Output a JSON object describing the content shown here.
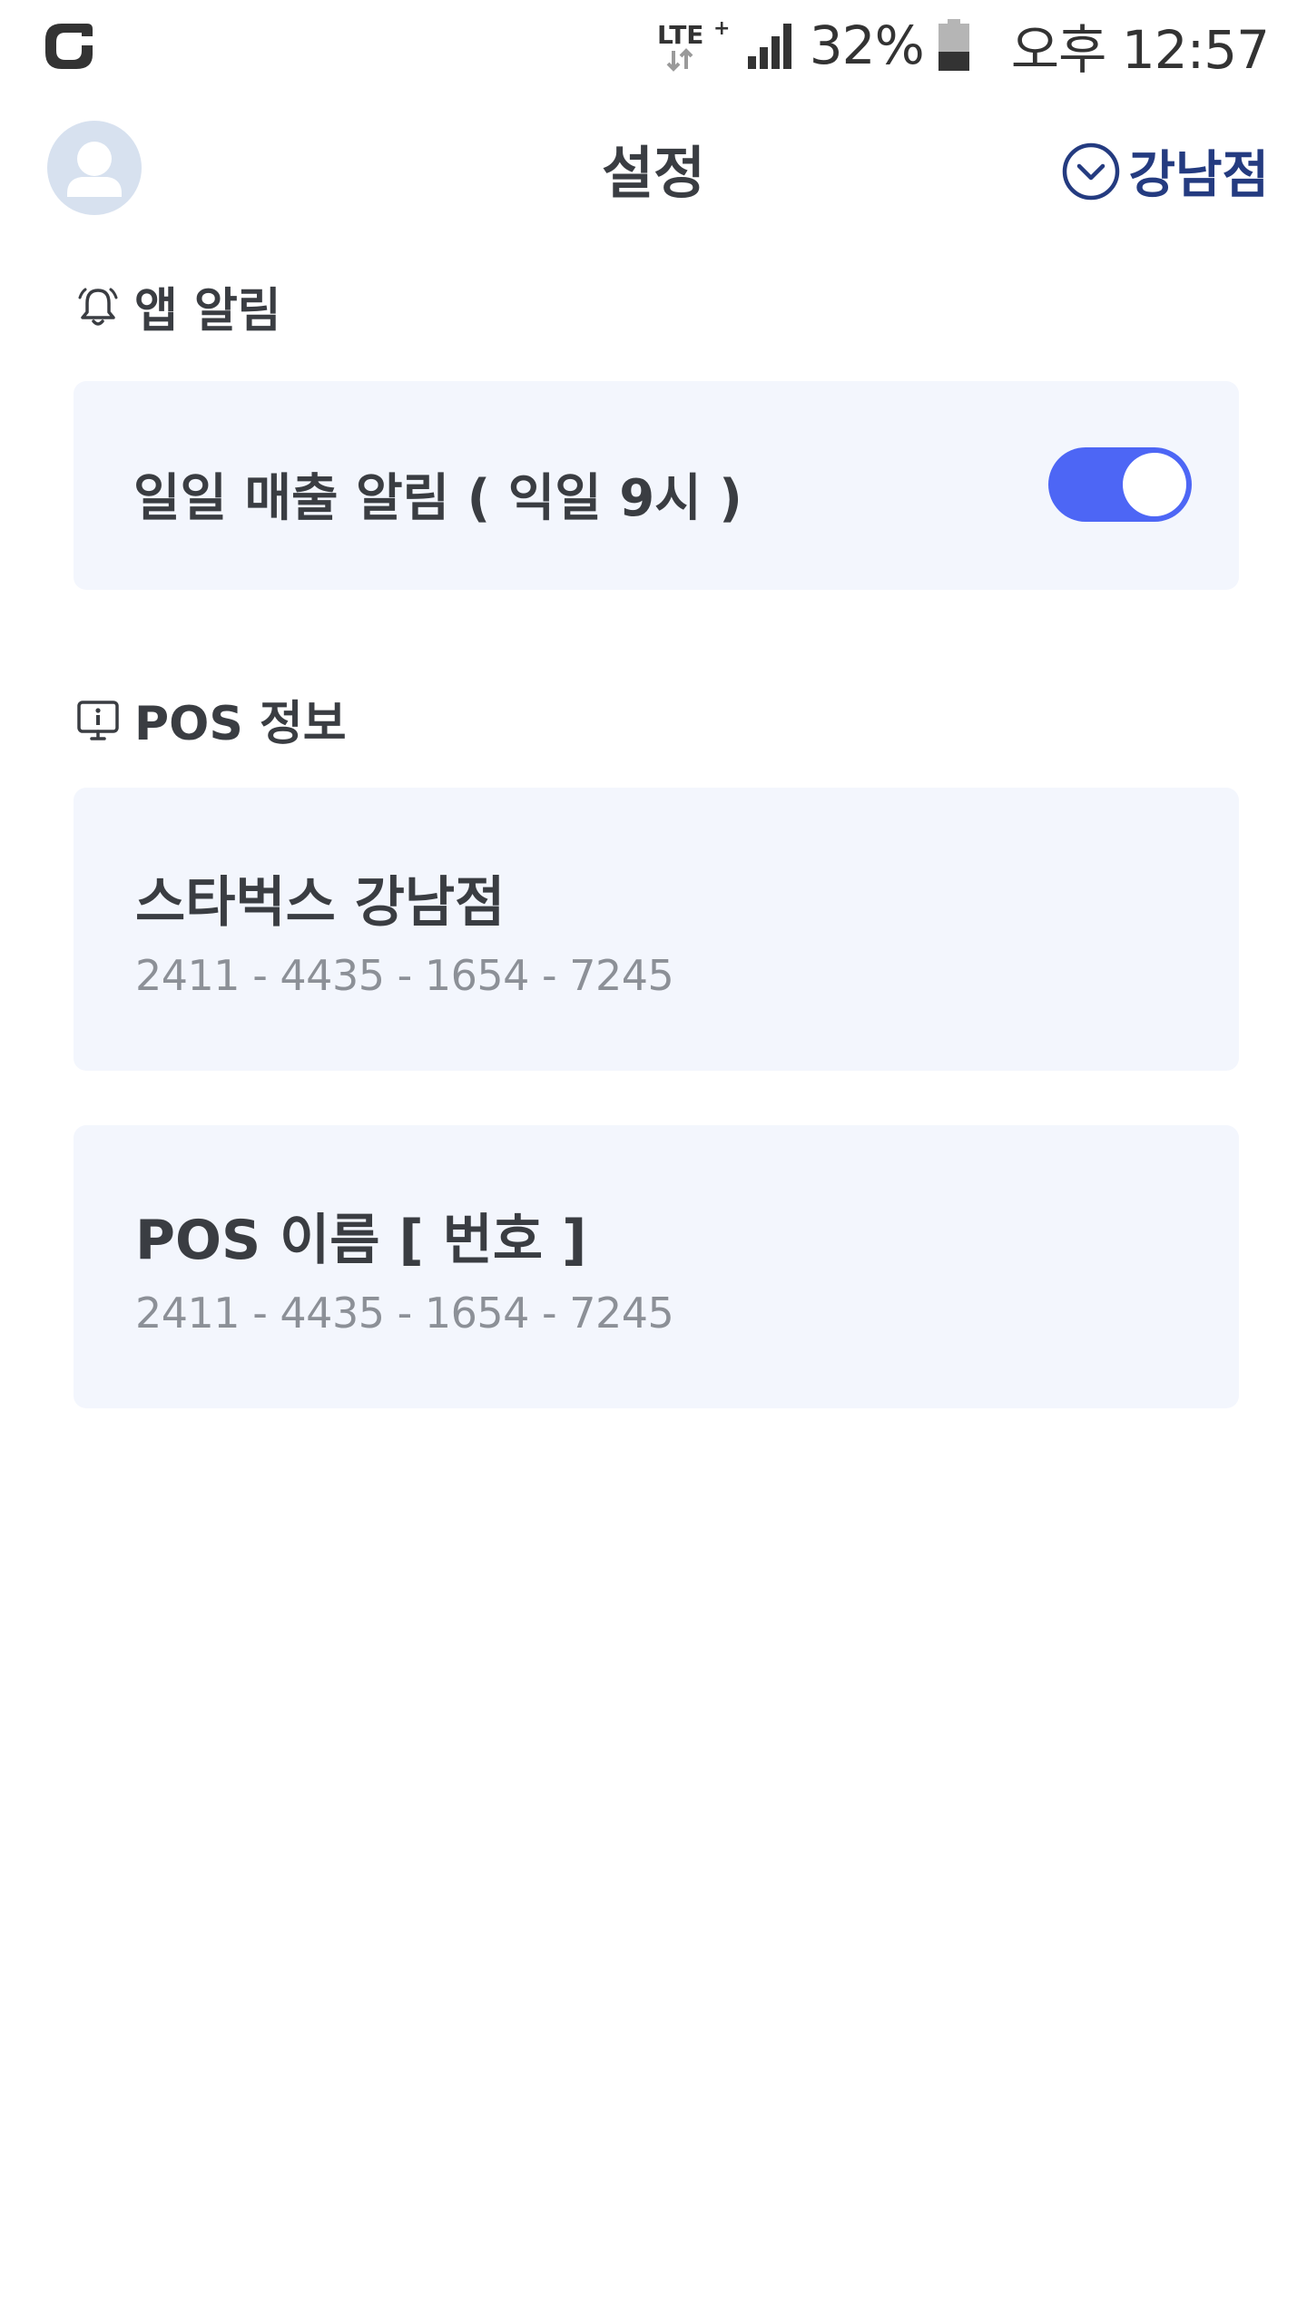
{
  "status_bar": {
    "battery_percent": "32%",
    "time": "오후 12:57",
    "network": "LTE+",
    "icons": [
      "carrier-logo-icon",
      "lte-icon",
      "signal-icon",
      "battery-icon"
    ],
    "battery_level": 0.32
  },
  "header": {
    "title": "설정",
    "store_selector_label": "강남점",
    "icons": [
      "avatar-icon",
      "chevron-down-circle-icon"
    ],
    "accent_color": "#243b80"
  },
  "app_alarm": {
    "section_title": "앱 알림",
    "section_icon": "bell-icon",
    "items": [
      {
        "label": "일일 매출 알림 ( 익일 9시 )",
        "enabled": true
      }
    ],
    "toggle_color": "#4d66f5"
  },
  "pos_info": {
    "section_title": "POS 정보",
    "section_icon": "pos-terminal-icon",
    "cards": [
      {
        "name": "스타벅스 강남점",
        "serial": "2411 - 4435 - 1654 - 7245"
      },
      {
        "name": "POS 이름 [ 번호 ]",
        "serial": "2411 - 4435 - 1654 - 7245"
      }
    ],
    "card_background": "#f3f6fd"
  }
}
